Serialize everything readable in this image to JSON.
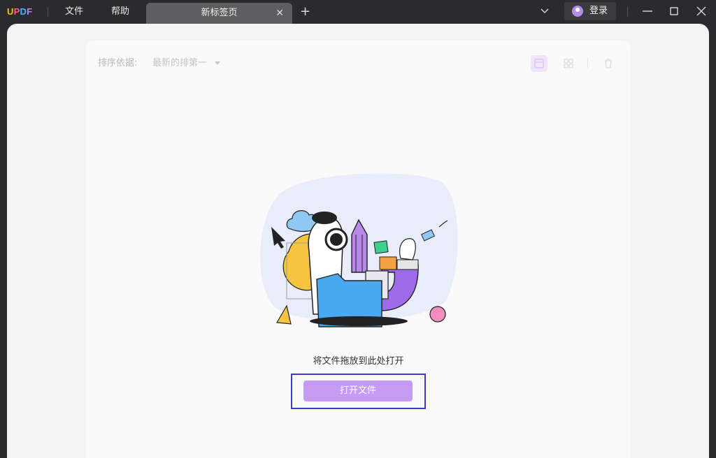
{
  "titlebar": {
    "logo": [
      "U",
      "P",
      "D",
      "F"
    ],
    "logo_colors": [
      "#f5c400",
      "#ff5b8b",
      "#41b9ff",
      "#b77ef5"
    ],
    "menu": {
      "file": "文件",
      "help": "帮助"
    },
    "tab": {
      "title": "新标签页",
      "close": "✕"
    },
    "add_tab": "+",
    "login": "登录"
  },
  "toolbar": {
    "sort_label": "排序依据:",
    "sort_value": "最新的排第一"
  },
  "main": {
    "drop_hint": "将文件拖放到此处打开",
    "open_button": "打开文件"
  },
  "colors": {
    "accent": "#c59bf5",
    "highlight_frame": "#3b3bd0",
    "titlebar": "#2b2b2e"
  }
}
